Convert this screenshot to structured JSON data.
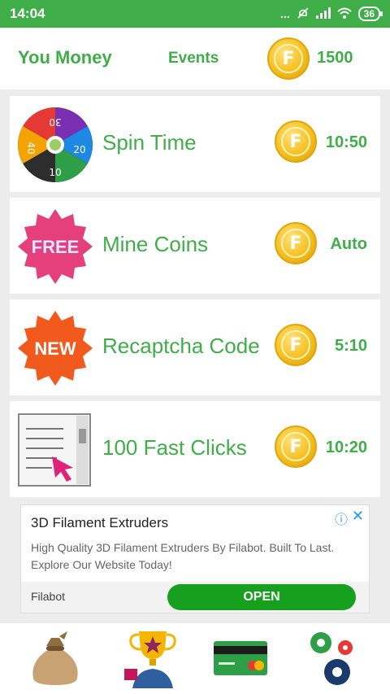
{
  "status_bar": {
    "time": "14:04",
    "signal_dots": "...",
    "battery": "36"
  },
  "header": {
    "title": "You Money",
    "events_label": "Events",
    "balance": "1500"
  },
  "coin_glyph": "F",
  "colors": {
    "accent": "#3fae49",
    "coin": "#f5c020",
    "open_button": "#16a01d",
    "ad_link": "#2196f3"
  },
  "tasks": [
    {
      "title": "Spin Time",
      "value": "10:50",
      "icon": "spin-wheel-icon"
    },
    {
      "title": "Mine Coins",
      "value": "Auto",
      "icon": "free-badge-icon"
    },
    {
      "title": "Recaptcha Code",
      "value": "5:10",
      "icon": "new-badge-icon"
    },
    {
      "title": "100 Fast Clicks",
      "value": "10:20",
      "icon": "click-window-icon"
    }
  ],
  "wheel_labels": [
    "30",
    "20",
    "10",
    "40"
  ],
  "badges": {
    "free": "FREE",
    "new": "NEW"
  },
  "ad": {
    "title": "3D Filament Extruders",
    "description": "High Quality 3D Filament Extruders By Filabot. Built To Last. Explore Our Website Today!",
    "advertiser": "Filabot",
    "cta": "OPEN"
  },
  "bottom_nav": [
    {
      "icon": "money-bag-icon"
    },
    {
      "icon": "trophy-icon"
    },
    {
      "icon": "credit-card-icon"
    },
    {
      "icon": "settings-gears-icon"
    }
  ]
}
